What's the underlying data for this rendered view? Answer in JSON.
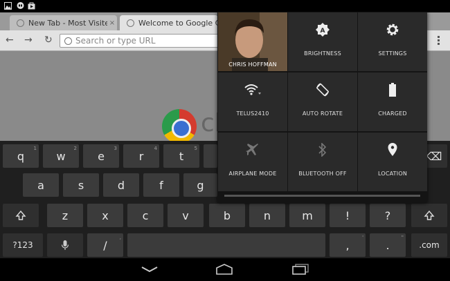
{
  "status_bar": {
    "icons": [
      "image-icon",
      "hangouts-icon",
      "play-store-icon"
    ]
  },
  "browser": {
    "tabs": [
      {
        "title": "New Tab - Most Visited",
        "close": "×"
      },
      {
        "title": "Welcome to Google Chro",
        "close": "×"
      }
    ],
    "omnibox_placeholder": "Search or type URL",
    "back": "←",
    "forward": "→",
    "reload": "↻",
    "logo_text": "ch"
  },
  "keyboard": {
    "row1": [
      {
        "label": "q",
        "hint": "1"
      },
      {
        "label": "w",
        "hint": "2"
      },
      {
        "label": "e",
        "hint": "3"
      },
      {
        "label": "r",
        "hint": "4"
      },
      {
        "label": "t",
        "hint": "5"
      }
    ],
    "row2": [
      "a",
      "s",
      "d",
      "f",
      "g"
    ],
    "row3": [
      {
        "label": "z",
        "hint": ""
      },
      {
        "label": "x",
        "hint": ""
      },
      {
        "label": "c",
        "hint": ""
      },
      {
        "label": "v",
        "hint": ""
      },
      {
        "label": "b",
        "hint": ""
      },
      {
        "label": "n",
        "hint": ""
      },
      {
        "label": "m",
        "hint": ""
      },
      {
        "label": "!",
        "hint": ""
      },
      {
        "label": "?",
        "hint": ""
      }
    ],
    "symbols_label": "?123",
    "slash": "/",
    "slash_hint": ",",
    "comma": ",",
    "comma_hint": "'",
    "period": ".",
    "period_hint": "\"",
    "com_label": ".com",
    "backspace": "⌫"
  },
  "nav_bar": {
    "back": "back-icon",
    "home": "home-icon",
    "recents": "recents-icon"
  },
  "quick_settings": {
    "profile_name": "CHRIS HOFFMAN",
    "tiles": [
      {
        "label": "BRIGHTNESS"
      },
      {
        "label": "SETTINGS"
      },
      {
        "label": "TELUS2410"
      },
      {
        "label": "AUTO ROTATE"
      },
      {
        "label": "CHARGED"
      },
      {
        "label": "AIRPLANE MODE"
      },
      {
        "label": "BLUETOOTH OFF"
      },
      {
        "label": "LOCATION"
      }
    ]
  }
}
